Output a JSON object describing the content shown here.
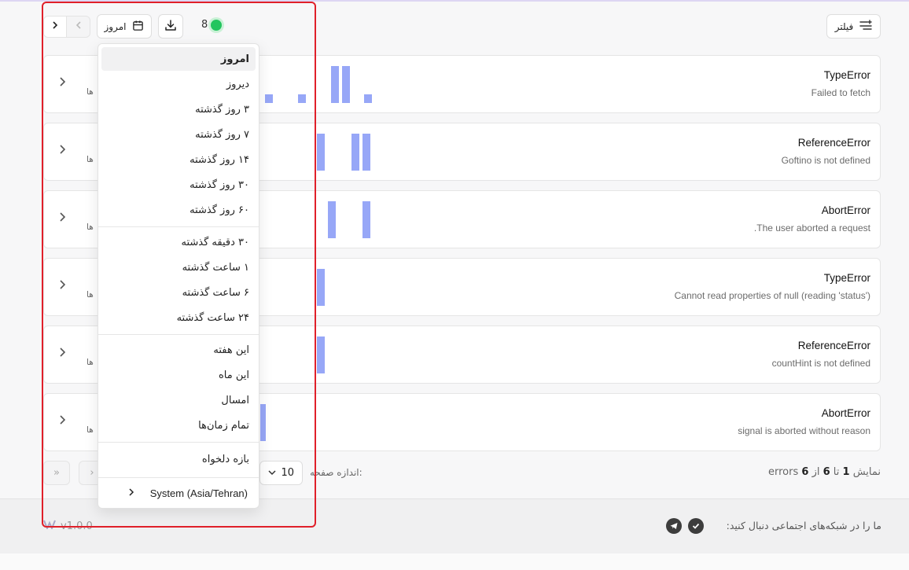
{
  "toolbar": {
    "filter_label": "فیلتر",
    "date_label": "امروز",
    "live_count": "8"
  },
  "errors": [
    {
      "title": "TypeError",
      "message": "Failed to fetch",
      "events_label": "ها"
    },
    {
      "title": "ReferenceError",
      "message": "Goftino is not defined",
      "events_label": "ها"
    },
    {
      "title": "AbortError",
      "message": ".The user aborted a request",
      "events_label": "ها"
    },
    {
      "title": "TypeError",
      "message": "Cannot read properties of null (reading 'status')",
      "events_label": "ها"
    },
    {
      "title": "ReferenceError",
      "message": "countHint is not defined",
      "events_label": "ها"
    },
    {
      "title": "AbortError",
      "message": "signal is aborted without reason",
      "events_label": "ها"
    }
  ],
  "pagination": {
    "prefix": "نمایش",
    "from": "1",
    "to_word": "تا",
    "to": "6",
    "of_word": "از",
    "total": "6",
    "unit": "errors",
    "page_size_label": "اندازه صفحه:",
    "page_size": "10"
  },
  "footer": {
    "follow_text": "ما را در شبکه‌های اجتماعی دنبال کنید:",
    "version": "v1.0.0"
  },
  "dropdown": {
    "items": [
      "امروز",
      "دیروز",
      "۳ روز گذشته",
      "۷ روز گذشته",
      "۱۴ روز گذشته",
      "۳۰ روز گذشته",
      "۶۰ روز گذشته",
      "۳۰ دقیقه گذشته",
      "۱ ساعت گذشته",
      "۶ ساعت گذشته",
      "۲۴ ساعت گذشته",
      "این هفته",
      "این ماه",
      "امسال",
      "تمام زمان‌ها",
      "بازه دلخواه"
    ],
    "selected": "امروز",
    "timezone": "System (Asia/Tehran)"
  },
  "colors": {
    "accent_bar": "#97a7f7",
    "live": "#22c55e",
    "highlight": "#e0202a"
  }
}
